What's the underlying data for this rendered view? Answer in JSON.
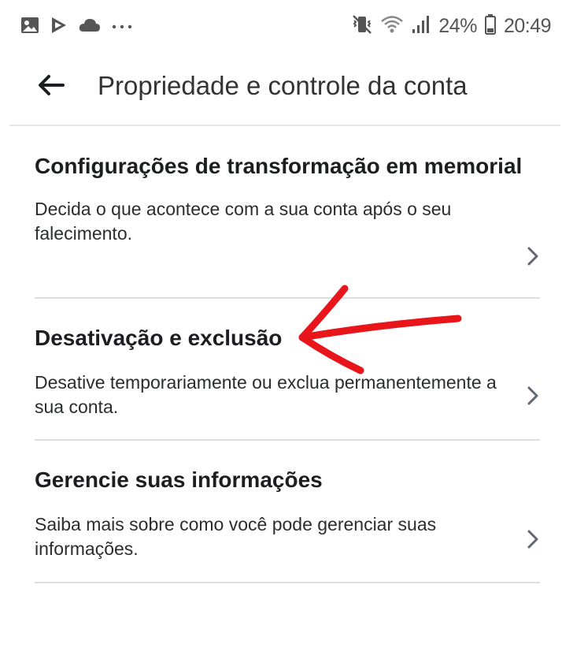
{
  "status_bar": {
    "battery": "24%",
    "time": "20:49",
    "left_icons": [
      "gallery-icon",
      "play-store-icon",
      "cloud-icon",
      "more-dots-icon"
    ],
    "right_icons": [
      "vibrate-mute-icon",
      "wifi-icon",
      "signal-icon",
      "battery-icon"
    ]
  },
  "app_bar": {
    "back_icon": "arrow-left-icon",
    "title": "Propriedade e controle da conta"
  },
  "items": [
    {
      "title": "Configurações de transformação em memorial",
      "description": "Decida o que acontece com a sua conta após o seu falecimento."
    },
    {
      "title": "Desativação e exclusão",
      "description": "Desative temporariamente ou exclua permanentemente a sua conta."
    },
    {
      "title": "Gerencie suas informações",
      "description": "Saiba mais sobre como você pode gerenciar suas informações."
    }
  ],
  "colors": {
    "annotation_arrow": "#e8151b",
    "divider": "#dadde1",
    "text_primary": "#1c1e21"
  }
}
